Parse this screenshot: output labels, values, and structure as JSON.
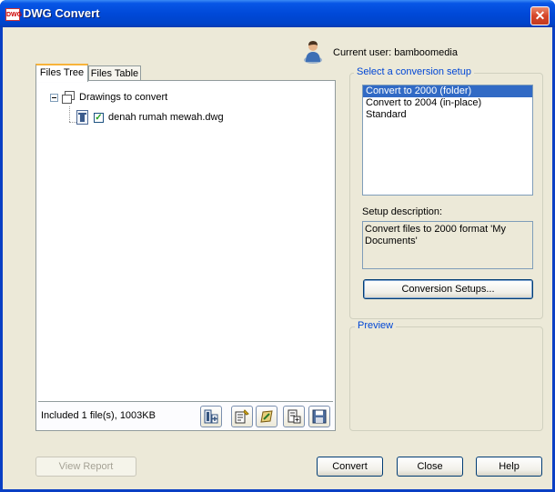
{
  "window": {
    "title": "DWG Convert",
    "app_icon_text": "DWG",
    "close_glyph": "✕"
  },
  "user": {
    "label": "Current user: bamboomedia",
    "icon": "user-icon"
  },
  "tabs": [
    {
      "label": "Files Tree",
      "active": true
    },
    {
      "label": "Files Table",
      "active": false
    }
  ],
  "tree": {
    "root": {
      "label": "Drawings to convert",
      "expanded": true
    },
    "children": [
      {
        "label": "denah rumah mewah.dwg",
        "checked": true
      }
    ]
  },
  "status": {
    "text": "Included 1 file(s), 1003KB"
  },
  "toolbar": {
    "buttons": [
      {
        "icon": "add-files-icon"
      },
      {
        "icon": "edit-list-icon"
      },
      {
        "icon": "insert-drawing-icon"
      },
      {
        "icon": "new-list-icon"
      },
      {
        "icon": "save-list-icon"
      }
    ]
  },
  "conversion": {
    "group_label": "Select a conversion setup",
    "setups": [
      {
        "label": "Convert to 2000 (folder)",
        "selected": true
      },
      {
        "label": "Convert to 2004 (in-place)",
        "selected": false
      },
      {
        "label": "Standard",
        "selected": false
      }
    ],
    "desc_label": "Setup description:",
    "description": "Convert files to 2000 format 'My Documents'",
    "setups_button": "Conversion Setups..."
  },
  "preview": {
    "group_label": "Preview"
  },
  "buttons": {
    "view_report": "View Report",
    "convert": "Convert",
    "close": "Close",
    "help": "Help"
  },
  "colors": {
    "titlebar": "#0049d8",
    "selection": "#316ac5",
    "group_label": "#0046d5",
    "face": "#ece9d8"
  }
}
